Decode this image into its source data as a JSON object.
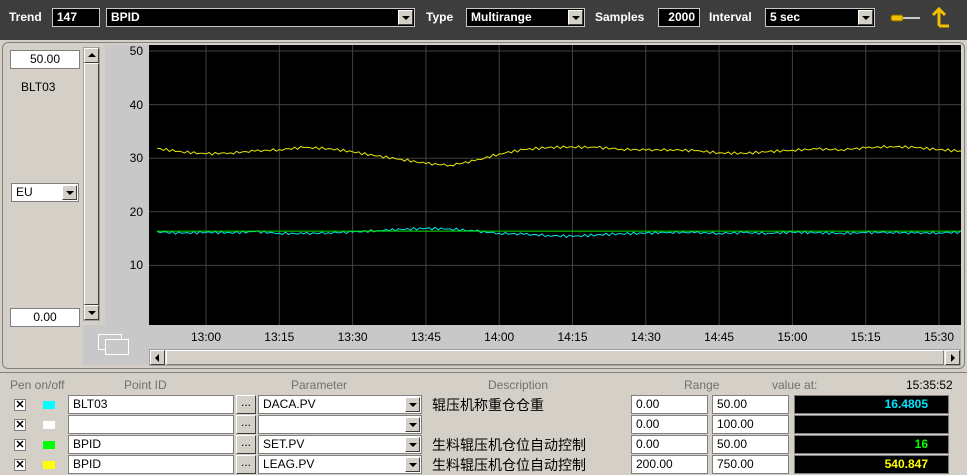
{
  "toolbar": {
    "trend_label": "Trend",
    "trend_number": "147",
    "trend_name": "BPID",
    "type_label": "Type",
    "type_value": "Multirange",
    "samples_label": "Samples",
    "samples_value": "2000",
    "interval_label": "Interval",
    "interval_value": "5 sec",
    "icons": [
      "pen-tool-icon",
      "up-arrow-icon"
    ]
  },
  "scale": {
    "max": "50.00",
    "min": "0.00",
    "point": "BLT03",
    "units": "EU"
  },
  "chart_data": {
    "type": "line",
    "ylim": [
      0,
      50
    ],
    "y_ticks": [
      "50",
      "40",
      "30",
      "20",
      "10"
    ],
    "x_ticks": [
      "13:00",
      "13:15",
      "13:30",
      "13:45",
      "14:00",
      "14:15",
      "14:30",
      "14:45",
      "15:00",
      "15:15",
      "15:30"
    ],
    "grid": true,
    "series": [
      {
        "color": "#e6e600",
        "x": [
          "12:50",
          "12:55",
          "13:00",
          "13:05",
          "13:10",
          "13:15",
          "13:20",
          "13:25",
          "13:30",
          "13:35",
          "13:40",
          "13:45",
          "13:50",
          "13:55",
          "14:00",
          "14:05",
          "14:10",
          "14:15",
          "14:20",
          "14:25",
          "14:30",
          "14:35",
          "14:40",
          "14:45",
          "14:50",
          "14:55",
          "15:00",
          "15:05",
          "15:10",
          "15:15",
          "15:20",
          "15:25",
          "15:30",
          "15:35"
        ],
        "values": [
          31.8,
          31.2,
          30.8,
          31.0,
          31.3,
          31.6,
          32.0,
          31.8,
          31.2,
          30.4,
          29.8,
          29.0,
          28.7,
          29.5,
          30.8,
          31.6,
          32.0,
          32.1,
          32.0,
          31.7,
          31.5,
          31.6,
          31.4,
          31.0,
          30.9,
          31.2,
          31.5,
          31.7,
          31.6,
          31.9,
          32.2,
          32.0,
          31.6,
          31.3
        ]
      },
      {
        "color": "#00e5e5",
        "x": [
          "12:50",
          "12:55",
          "13:00",
          "13:05",
          "13:10",
          "13:15",
          "13:20",
          "13:25",
          "13:30",
          "13:35",
          "13:40",
          "13:45",
          "13:50",
          "13:55",
          "14:00",
          "14:05",
          "14:10",
          "14:15",
          "14:20",
          "14:25",
          "14:30",
          "14:35",
          "14:40",
          "14:45",
          "14:50",
          "14:55",
          "15:00",
          "15:05",
          "15:10",
          "15:15",
          "15:20",
          "15:25",
          "15:30",
          "15:35"
        ],
        "values": [
          16.3,
          16.0,
          16.2,
          16.1,
          16.3,
          16.0,
          15.9,
          16.1,
          16.2,
          16.5,
          16.7,
          16.9,
          16.8,
          16.4,
          16.0,
          15.8,
          15.6,
          15.4,
          15.7,
          15.9,
          16.0,
          16.2,
          16.1,
          16.0,
          16.1,
          16.0,
          16.2,
          16.1,
          16.0,
          16.1,
          16.2,
          16.0,
          16.1,
          16.2
        ]
      },
      {
        "color": "#00e600",
        "x": [
          "12:50",
          "15:35"
        ],
        "values": [
          16.4,
          16.4
        ]
      }
    ]
  },
  "pens": {
    "headers": {
      "pen": "Pen on/off",
      "point": "Point ID",
      "parameter": "Parameter",
      "description": "Description",
      "range": "Range",
      "value_at": "value at:",
      "time": "15:35:52"
    },
    "rows": [
      {
        "checked": "✕",
        "color": "#00ffff",
        "point": "BLT03",
        "param": "DACA.PV",
        "desc": "辊压机称重仓仓重",
        "lo": "0.00",
        "hi": "50.00",
        "value": "16.4805",
        "value_color": "#00e5ff"
      },
      {
        "checked": "✕",
        "color": "#ffffff",
        "point": "",
        "param": "",
        "desc": "",
        "lo": "0.00",
        "hi": "100.00",
        "value": "",
        "value_color": "#ffffff"
      },
      {
        "checked": "✕",
        "color": "#00ff00",
        "point": "BPID",
        "param": "SET.PV",
        "desc": "生料辊压机仓位自动控制",
        "lo": "0.00",
        "hi": "50.00",
        "value": "16",
        "value_color": "#00ff00"
      },
      {
        "checked": "✕",
        "color": "#ffff00",
        "point": "BPID",
        "param": "LEAG.PV",
        "desc": "生料辊压机仓位自动控制",
        "lo": "200.00",
        "hi": "750.00",
        "value": "540.847",
        "value_color": "#ffff00"
      }
    ]
  }
}
